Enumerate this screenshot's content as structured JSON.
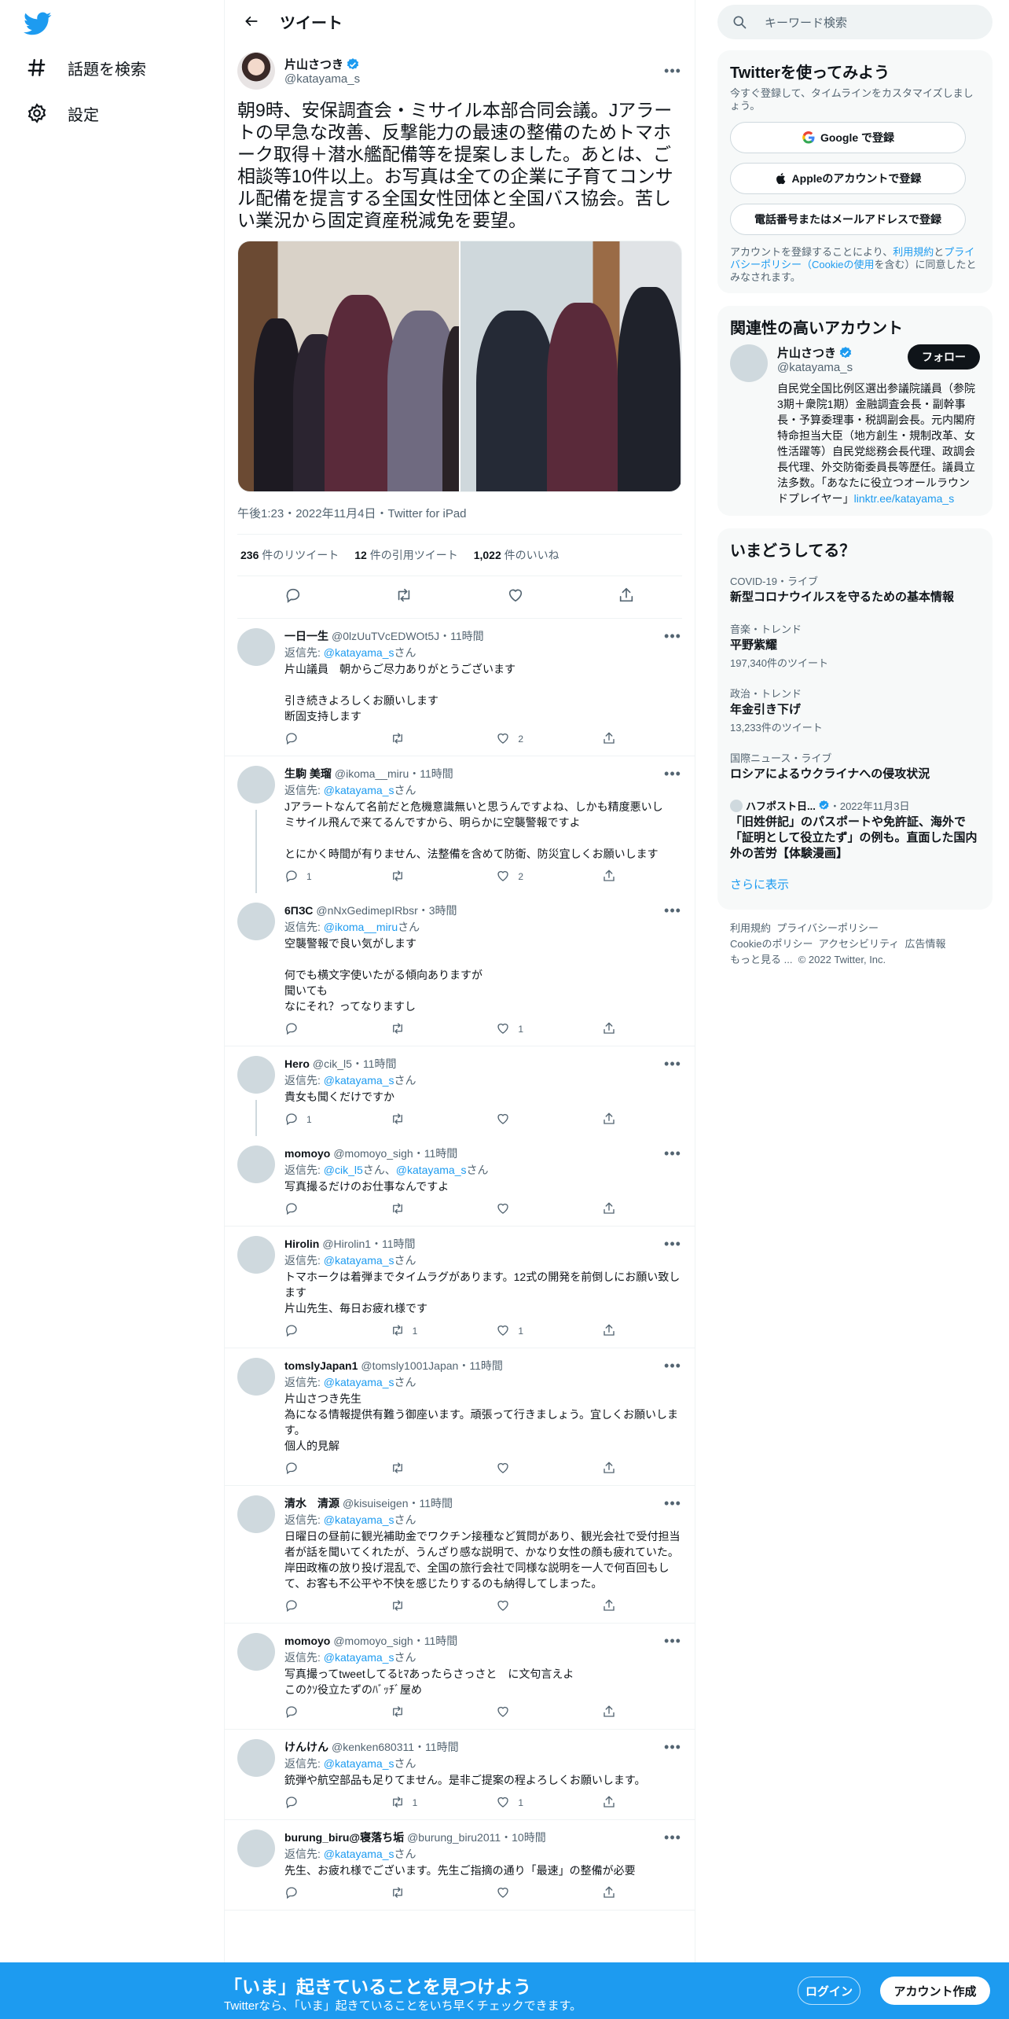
{
  "nav": {
    "items": [
      {
        "label": "話題を検索",
        "icon": "hashtag-icon"
      },
      {
        "label": "設定",
        "icon": "gear-icon"
      }
    ]
  },
  "header": {
    "title": "ツイート"
  },
  "tweet": {
    "display_name": "片山さつき",
    "handle": "@katayama_s",
    "text": "朝9時、安保調査会・ミサイル本部合同会議。Jアラートの早急な改善、反撃能力の最速の整備のためトマホーク取得＋潜水艦配備等を提案しました。あとは、ご相談等10件以上。お写真は全ての企業に子育てコンサル配備を提言する全国女性団体と全国バス協会。苦しい業況から固定資産税減免を要望。",
    "timestamp": "午後1:23・2022年11月4日・Twitter for iPad",
    "retweets": "236",
    "retweets_label": "件のリツイート",
    "quotes": "12",
    "quotes_label": "件の引用ツイート",
    "likes": "1,022",
    "likes_label": "件のいいね"
  },
  "replies": [
    {
      "name": "一日一生",
      "handle": "@0lzUuTVcEDWOt5J・11時間",
      "reply_prefix": "返信先: ",
      "reply_to": "@katayama_s",
      "reply_suffix": "さん",
      "text": "片山議員　朝からご尽力ありがとうございます\n\n引き続きよろしくお願いします\n断固支持します",
      "replies": "",
      "retweets": "",
      "likes": "2",
      "thread": false
    },
    {
      "name": "生駒 美瑠",
      "handle": "@ikoma__miru・11時間",
      "reply_prefix": "返信先: ",
      "reply_to": "@katayama_s",
      "reply_suffix": "さん",
      "text": "Jアラートなんて名前だと危機意識無いと思うんですよね、しかも精度悪いし\nミサイル飛んで来てるんですから、明らかに空襲警報ですよ\n\nとにかく時間が有りません、法整備を含めて防衛、防災宜しくお願いします",
      "replies": "1",
      "retweets": "",
      "likes": "2",
      "thread": true
    },
    {
      "name": "6ПЗС",
      "handle": "@nNxGedimepIRbsr・3時間",
      "reply_prefix": "返信先: ",
      "reply_to": "@ikoma__miru",
      "reply_suffix": "さん",
      "text": "空襲警報で良い気がします\n\n何でも横文字使いたがる傾向ありますが\n聞いても\nなにそれ？ってなりますし",
      "replies": "",
      "retweets": "",
      "likes": "1",
      "thread": false
    },
    {
      "name": "Hero",
      "handle": "@cik_l5・11時間",
      "reply_prefix": "返信先: ",
      "reply_to": "@katayama_s",
      "reply_suffix": "さん",
      "text": "貴女も聞くだけですか",
      "replies": "1",
      "retweets": "",
      "likes": "",
      "thread": true
    },
    {
      "name": "momoyo",
      "handle": "@momoyo_sigh・11時間",
      "reply_prefix": "返信先: ",
      "reply_to": "@cik_l5",
      "reply_suffix": "さん、",
      "reply_to2": "@katayama_s",
      "reply_suffix2": "さん",
      "text": "写真撮るだけのお仕事なんですよ",
      "replies": "",
      "retweets": "",
      "likes": "",
      "thread": false
    },
    {
      "name": "Hirolin",
      "handle": "@Hirolin1・11時間",
      "reply_prefix": "返信先: ",
      "reply_to": "@katayama_s",
      "reply_suffix": "さん",
      "text": "トマホークは着弾までタイムラグがあります。12式の開発を前倒しにお願い致します\n片山先生、毎日お疲れ様です",
      "replies": "",
      "retweets": "1",
      "likes": "1",
      "thread": false
    },
    {
      "name": "tomslyJapan1",
      "handle": "@tomsly1001Japan・11時間",
      "reply_prefix": "返信先: ",
      "reply_to": "@katayama_s",
      "reply_suffix": "さん",
      "text": "片山さつき先生\n為になる情報提供有難う御座います。頑張って行きましょう。宜しくお願いします。\n個人的見解",
      "replies": "",
      "retweets": "",
      "likes": "",
      "thread": false
    },
    {
      "name": "清水　清源",
      "handle": "@kisuiseigen・11時間",
      "reply_prefix": "返信先: ",
      "reply_to": "@katayama_s",
      "reply_suffix": "さん",
      "text": "日曜日の昼前に観光補助金でワクチン接種など質問があり、観光会社で受付担当者が話を聞いてくれたが、うんざり感な説明で、かなり女性の顔も疲れていた。\n岸田政権の放り投げ混乱で、全国の旅行会社で同様な説明を一人で何百回もして、お客も不公平や不快を感じたりするのも納得してしまった。",
      "replies": "",
      "retweets": "",
      "likes": "",
      "thread": false
    },
    {
      "name": "momoyo",
      "handle": "@momoyo_sigh・11時間",
      "reply_prefix": "返信先: ",
      "reply_to": "@katayama_s",
      "reply_suffix": "さん",
      "text": "写真撮ってtweetしてるﾋﾏあったらさっさと　に文句言えよ\nこのｸｿ役立たずのﾊﾞｯﾁﾞ屋め",
      "replies": "",
      "retweets": "",
      "likes": "",
      "thread": false
    },
    {
      "name": "けんけん",
      "handle": "@kenken680311・11時間",
      "reply_prefix": "返信先: ",
      "reply_to": "@katayama_s",
      "reply_suffix": "さん",
      "text": "銃弾や航空部品も足りてません。是非ご提案の程よろしくお願いします。",
      "replies": "",
      "retweets": "1",
      "likes": "1",
      "thread": false
    },
    {
      "name": "burung_biru@寝落ち垢",
      "handle": "@burung_biru2011・10時間",
      "reply_prefix": "返信先: ",
      "reply_to": "@katayama_s",
      "reply_suffix": "さん",
      "text": "先生、お疲れ様でございます。先生ご指摘の通り「最速」の整備が必要",
      "replies": "",
      "retweets": "",
      "likes": "",
      "thread": false
    }
  ],
  "search": {
    "placeholder": "キーワード検索"
  },
  "signup": {
    "title": "Twitterを使ってみよう",
    "subtitle": "今すぐ登録して、タイムラインをカスタマイズしましょう。",
    "google": "Google で登録",
    "apple": "Appleのアカウントで登録",
    "phone": "電話番号またはメールアドレスで登録",
    "legal_prefix": "アカウントを登録することにより、",
    "terms": "利用規約",
    "and": "と",
    "privacy": "プライバシーポリシー（Cookieの使用",
    "legal_suffix": "を含む）に同意したとみなされます。"
  },
  "related": {
    "title": "関連性の高いアカウント",
    "name": "片山さつき",
    "handle": "@katayama_s",
    "follow": "フォロー",
    "bio": "自民党全国比例区選出参議院議員（参院3期＋衆院1期）金融調査会長・副幹事長・予算委理事・税調副会長。元内閣府特命担当大臣（地方創生・規制改革、女性活躍等）自民党総務会長代理、政調会長代理、外交防衛委員長等歴任。議員立法多数。「あなたに役立つオールラウンドプレイヤー」",
    "link": "linktr.ee/katayama_s"
  },
  "trends": {
    "title": "いまどうしてる？",
    "items": [
      {
        "category": "COVID-19・ライブ",
        "title": "新型コロナウイルスを守るための基本情報",
        "count": ""
      },
      {
        "category": "音楽・トレンド",
        "title": "平野紫耀",
        "count": "197,340件のツイート"
      },
      {
        "category": "政治・トレンド",
        "title": "年金引き下げ",
        "count": "13,233件のツイート"
      },
      {
        "category": "国際ニュース・ライブ",
        "title": "ロシアによるウクライナへの侵攻状況",
        "count": ""
      }
    ],
    "news_source": "ハフポスト日...",
    "news_date": "・2022年11月3日",
    "news_title": "「旧姓併記」のパスポートや免許証、海外で「証明として役立たず」の例も。直面した国内外の苦労【体験漫画】",
    "show_more": "さらに表示"
  },
  "footer": {
    "links": [
      "利用規約",
      "プライバシーポリシー",
      "Cookieのポリシー",
      "アクセシビリティ",
      "広告情報",
      "もっと見る ..."
    ],
    "copyright": "© 2022 Twitter, Inc."
  },
  "bottom_bar": {
    "title": "「いま」起きていることを見つけよう",
    "subtitle": "Twitterなら、「いま」起きていることをいち早くチェックできます。",
    "login": "ログイン",
    "signup": "アカウント作成"
  },
  "colors": {
    "accent": "#1d9bf0",
    "text": "#0f1419",
    "secondary": "#536471"
  }
}
